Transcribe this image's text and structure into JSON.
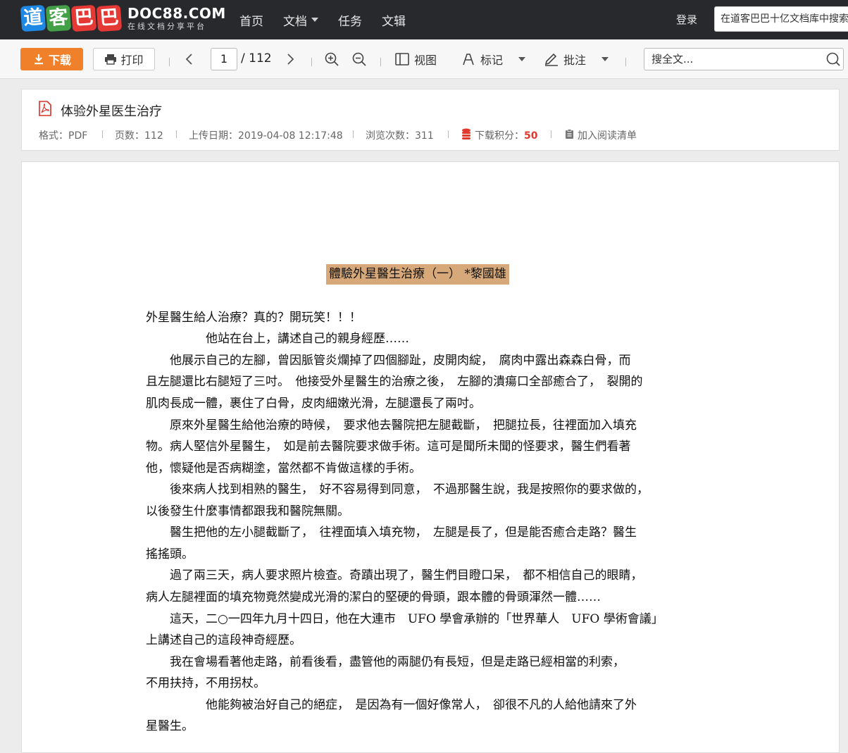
{
  "header": {
    "logo_chars": [
      {
        "char": "道",
        "color": "#1e88e5"
      },
      {
        "char": "客",
        "color": "#43a047"
      },
      {
        "char": "巴",
        "color": "#e53935"
      },
      {
        "char": "巴",
        "color": "#e53935"
      }
    ],
    "brand_title": "DOC88.COM",
    "brand_subtitle": "在线文档分享平台",
    "nav": [
      "首页",
      "文档",
      "任务",
      "文辑"
    ],
    "login": "登录",
    "search_placeholder": "在道客巴巴十亿文档库中搜索"
  },
  "toolbar": {
    "download": "下载",
    "print": "打印",
    "current_page": "1",
    "total_pages": "/ 112",
    "view": "视图",
    "mark": "标记",
    "annotate": "批注",
    "search_placeholder": "搜全文..."
  },
  "doc_info": {
    "title": "体验外星医生治疗",
    "format": "格式：PDF",
    "pages": "页数：112",
    "upload_date": "上传日期：2019-04-08 12:17:48",
    "views": "浏览次数：311",
    "points_label": "下载积分：",
    "points_value": "50",
    "add_reading": "加入阅读清单"
  },
  "colors": {
    "accent_orange": "#f0802a",
    "points_red": "#e03a2f",
    "heading_highlight": "#d7a97a"
  },
  "document": {
    "heading": "體驗外星醫生治療（一）  *黎國雄",
    "lines": [
      "外星醫生給人治療？真的？開玩笑！！！",
      "　　　　　他站在台上，講述自己的親身經歷……",
      "　　他展示自己的左腳，曾因脈管炎爛掉了四個腳趾，皮開肉綻，　腐肉中露出森森白骨，而",
      "且左腿還比右腿短了三吋。　他接受外星醫生的治療之後，　左腳的潰瘍口全部癒合了，　裂開的",
      "肌肉長成一體，裹住了白骨，皮肉細嫩光滑，左腿還長了兩吋。",
      "　　原來外星醫生給他治療的時候，　要求他去醫院把左腿截斷，　把腿拉長，往裡面加入填充",
      "物。病人堅信外星醫生，　如是前去醫院要求做手術。這可是聞所未聞的怪要求，醫生們看著",
      "他，懷疑他是否病糊塗，當然都不肯做這樣的手術。",
      "　　後來病人找到相熟的醫生，　好不容易得到同意，　不過那醫生說，我是按照你的要求做的，",
      "以後發生什麼事情都跟我和醫院無關。",
      "　　醫生把他的左小腿截斷了，　往裡面填入填充物，　左腿是長了，但是能否癒合走路？醫生",
      "搖搖頭。",
      "　　過了兩三天，病人要求照片檢查。奇蹟出現了，醫生們目瞪口呆，　都不相信自己的眼睛，",
      "病人左腿裡面的填充物竟然變成光滑的潔白的堅硬的骨頭，跟本體的骨頭渾然一體……",
      "　　這天，二○一四年九月十四日，他在大連市　UFO 學會承辦的「世界華人　UFO 學術會議」",
      "上講述自己的這段神奇經歷。",
      "　　我在會場看著他走路，前看後看，盡管他的兩腿仍有長短，但是走路已經相當的利索，",
      "不用扶持，不用拐杖。",
      "　　　　　他能夠被治好自己的絕症，　是因為有一個好像常人，　卻很不凡的人給他請來了外",
      "星醫生。"
    ]
  }
}
